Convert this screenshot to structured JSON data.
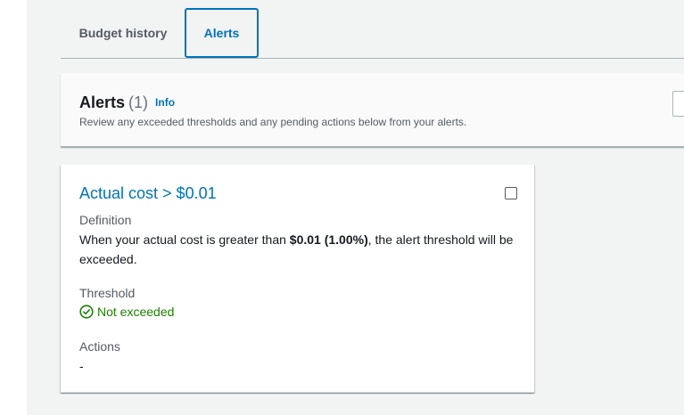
{
  "tabs": {
    "budget_history": "Budget history",
    "alerts": "Alerts"
  },
  "alerts_panel": {
    "title": "Alerts",
    "count": "(1)",
    "info_link": "Info",
    "description": "Review any exceeded thresholds and any pending actions below from your alerts."
  },
  "alert_card": {
    "title": "Actual cost > $0.01",
    "definition_label": "Definition",
    "definition_prefix": "When your actual cost is greater than ",
    "definition_bold": "$0.01 (1.00%)",
    "definition_suffix": ", the alert threshold will be exceeded.",
    "threshold_label": "Threshold",
    "threshold_value": "Not exceeded",
    "actions_label": "Actions",
    "actions_value": "-"
  },
  "colors": {
    "link": "#0073bb",
    "success": "#1d8102",
    "background": "#f2f3f3"
  },
  "icons": {
    "threshold_status": "check-circle-icon"
  }
}
